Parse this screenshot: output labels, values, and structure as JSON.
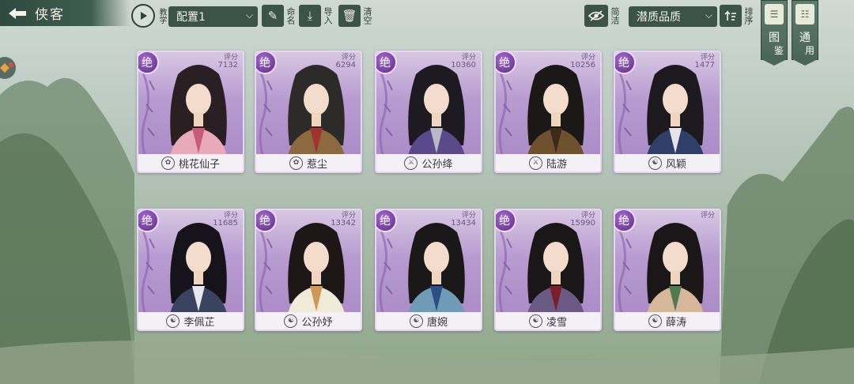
{
  "header": {
    "back_icon": "back-arrow-icon",
    "title": "侠客",
    "tutorial_label": "教学",
    "config_value": "配置1",
    "rename_label": "命名",
    "import_label": "导入",
    "clear_label": "清空",
    "simple_label": "简洁",
    "quality_value": "潜质品质",
    "sort_label": "排序",
    "tujian_label_1": "图",
    "tujian_label_2": "鉴",
    "tongyong_label_1": "通",
    "tongyong_label_2": "用"
  },
  "score_label": "评分",
  "cards": [
    {
      "name": "桃花仙子",
      "grade": "绝",
      "score": "7132",
      "faction": "lotus",
      "hair": "#2a1f22",
      "robe": "#e8a9b8",
      "accent": "#c75b7a"
    },
    {
      "name": "惹尘",
      "grade": "绝",
      "score": "6294",
      "faction": "lotus",
      "hair": "#2d2b2a",
      "robe": "#8c6a3f",
      "accent": "#a0342d"
    },
    {
      "name": "公孙绛",
      "grade": "绝",
      "score": "10360",
      "faction": "sword",
      "hair": "#1e1a22",
      "robe": "#5a4a8c",
      "accent": "#b8b8c8"
    },
    {
      "name": "陆游",
      "grade": "绝",
      "score": "10256",
      "faction": "sword",
      "hair": "#1c1818",
      "robe": "#6e5230",
      "accent": "#3d2b1a"
    },
    {
      "name": "风颖",
      "grade": "绝",
      "score": "1477",
      "faction": "taiji",
      "hair": "#1c1a1e",
      "robe": "#2f3f6a",
      "accent": "#e8e2ea"
    },
    {
      "name": "李佩芷",
      "grade": "绝",
      "score": "11685",
      "faction": "taiji",
      "hair": "#16141a",
      "robe": "#3a4460",
      "accent": "#e9e7ee"
    },
    {
      "name": "公孙妤",
      "grade": "绝",
      "score": "13342",
      "faction": "taiji",
      "hair": "#1d1817",
      "robe": "#f0ead8",
      "accent": "#d09a56"
    },
    {
      "name": "唐婉",
      "grade": "绝",
      "score": "13434",
      "faction": "taiji",
      "hair": "#1a1818",
      "robe": "#6f9bb6",
      "accent": "#2d4f86"
    },
    {
      "name": "凌雪",
      "grade": "绝",
      "score": "15990",
      "faction": "taiji",
      "hair": "#1a1719",
      "robe": "#6c5a86",
      "accent": "#7b1f2a"
    },
    {
      "name": "薛涛",
      "grade": "绝",
      "score": "",
      "faction": "taiji",
      "hair": "#1b1718",
      "robe": "#d7b79a",
      "accent": "#4f7a4f"
    }
  ]
}
